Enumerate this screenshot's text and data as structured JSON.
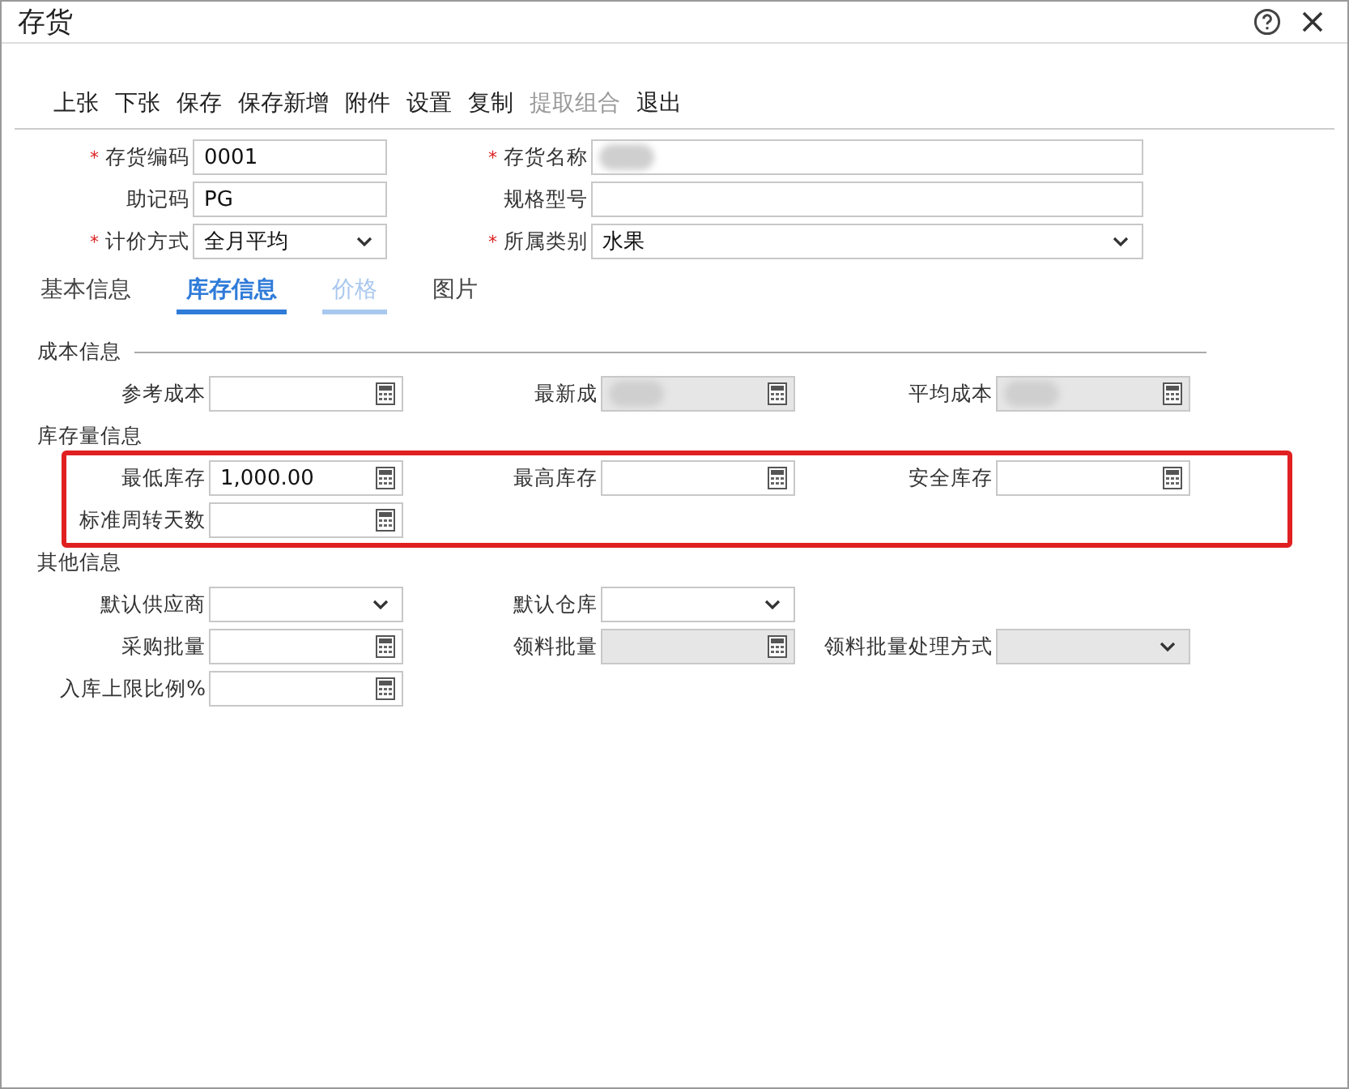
{
  "window": {
    "title": "存货"
  },
  "toolbar": [
    {
      "label": "上张",
      "disabled": false
    },
    {
      "label": "下张",
      "disabled": false
    },
    {
      "label": "保存",
      "disabled": false
    },
    {
      "label": "保存新增",
      "disabled": false
    },
    {
      "label": "附件",
      "disabled": false
    },
    {
      "label": "设置",
      "disabled": false
    },
    {
      "label": "复制",
      "disabled": false
    },
    {
      "label": "提取组合",
      "disabled": true
    },
    {
      "label": "退出",
      "disabled": false
    }
  ],
  "header_fields": [
    {
      "label": "存货编码",
      "required_mark": "*",
      "kind": "text",
      "value": "0001",
      "redacted": false
    },
    {
      "label": "存货名称",
      "required_mark": "*",
      "kind": "text",
      "redacted": true
    },
    {
      "label": "助记码",
      "kind": "text",
      "value": "PG",
      "redacted": false
    },
    {
      "label": "规格型号",
      "kind": "text",
      "redacted": false
    },
    {
      "label": "计价方式",
      "required_mark": "*",
      "kind": "select",
      "value": "全月平均",
      "redacted": false
    },
    {
      "label": "所属类别",
      "required_mark": "*",
      "kind": "select",
      "value": "水果",
      "redacted": false
    }
  ],
  "tabs": [
    {
      "label": "基本信息",
      "selected": false,
      "disabled": false
    },
    {
      "label": "库存信息",
      "selected": true,
      "disabled": false
    },
    {
      "label": "价格",
      "selected": false,
      "disabled": true
    },
    {
      "label": "图片",
      "selected": false,
      "disabled": false
    }
  ],
  "sections": [
    {
      "title": "成本信息",
      "rule": true,
      "rows": [
        [
          {
            "label": "参考成本",
            "kind": "calc",
            "disabled": false,
            "redacted": false
          },
          {
            "label": "最新成",
            "kind": "calc",
            "disabled": true,
            "redacted": true
          },
          {
            "label": "平均成本",
            "kind": "calc",
            "disabled": true,
            "redacted": true
          }
        ]
      ]
    },
    {
      "title": "库存量信息",
      "rule": false,
      "rows": [
        [
          {
            "label": "最低库存",
            "kind": "calc",
            "value": "1,000.00",
            "disabled": false,
            "redacted": false
          },
          {
            "label": "最高库存",
            "kind": "calc",
            "disabled": false,
            "redacted": false
          },
          {
            "label": "安全库存",
            "kind": "calc",
            "disabled": false,
            "redacted": false
          }
        ],
        [
          {
            "label": "标准周转天数",
            "kind": "calc",
            "disabled": false,
            "redacted": false
          }
        ]
      ]
    },
    {
      "title": "其他信息",
      "rule": false,
      "rows": [
        [
          {
            "label": "默认供应商",
            "kind": "select",
            "disabled": false,
            "redacted": false
          },
          {
            "label": "默认仓库",
            "kind": "select",
            "disabled": false,
            "redacted": false
          }
        ],
        [
          {
            "label": "采购批量",
            "kind": "calc",
            "disabled": false,
            "redacted": false
          },
          {
            "label": "领料批量",
            "kind": "calc",
            "disabled": true,
            "redacted": false
          },
          {
            "label": "领料批量处理方式",
            "kind": "select",
            "disabled": true,
            "redacted": false
          }
        ],
        [
          {
            "label": "入库上限比例%",
            "kind": "calc",
            "disabled": false,
            "redacted": false
          }
        ]
      ]
    }
  ],
  "highlight": {
    "visible": true
  }
}
